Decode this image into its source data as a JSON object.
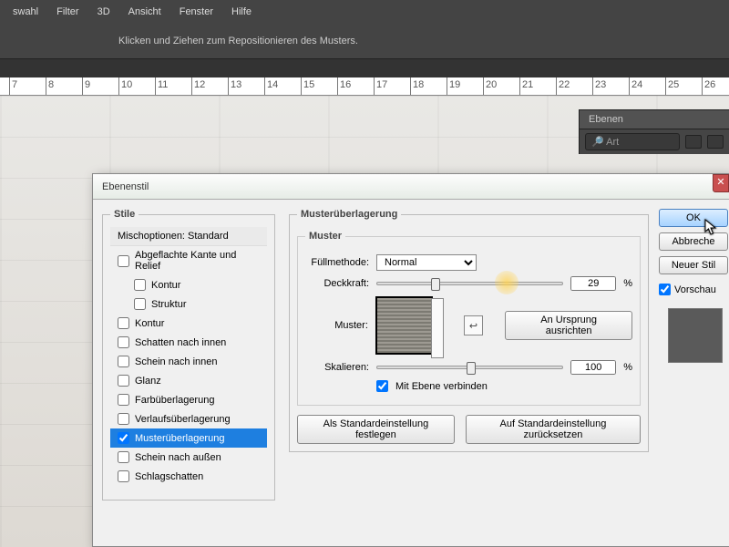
{
  "menu": [
    "swahl",
    "Filter",
    "3D",
    "Ansicht",
    "Fenster",
    "Hilfe"
  ],
  "hint": "Klicken und Ziehen zum Repositionieren des Musters.",
  "ruler": [
    "7",
    "8",
    "9",
    "10",
    "11",
    "12",
    "13",
    "14",
    "15",
    "16",
    "17",
    "18",
    "19",
    "20",
    "21",
    "22",
    "23",
    "24",
    "25",
    "26"
  ],
  "layers_panel": {
    "title": "Ebenen",
    "kind": "Art"
  },
  "dialog": {
    "title": "Ebenenstil",
    "styles_header": "Stile",
    "blend_header": "Mischoptionen: Standard",
    "styles": [
      "Abgeflachte Kante und Relief",
      "Kontur",
      "Struktur",
      "Kontur",
      "Schatten nach innen",
      "Schein nach innen",
      "Glanz",
      "Farbüberlagerung",
      "Verlaufsüberlagerung",
      "Musterüberlagerung",
      "Schein nach außen",
      "Schlagschatten"
    ],
    "selected_index": 9,
    "overlay": {
      "legend": "Musterüberlagerung",
      "inner_legend": "Muster",
      "blendmode_label": "Füllmethode:",
      "blendmode": "Normal",
      "opacity_label": "Deckkraft:",
      "opacity": "29",
      "pct": "%",
      "pattern_label": "Muster:",
      "snap_label": "An Ursprung ausrichten",
      "scale_label": "Skalieren:",
      "scale": "100",
      "link_label": "Mit Ebene verbinden",
      "default_btn": "Als Standardeinstellung festlegen",
      "reset_btn": "Auf Standardeinstellung zurücksetzen"
    },
    "buttons": {
      "ok": "OK",
      "cancel": "Abbreche",
      "newstyle": "Neuer Stil",
      "preview": "Vorschau"
    }
  }
}
